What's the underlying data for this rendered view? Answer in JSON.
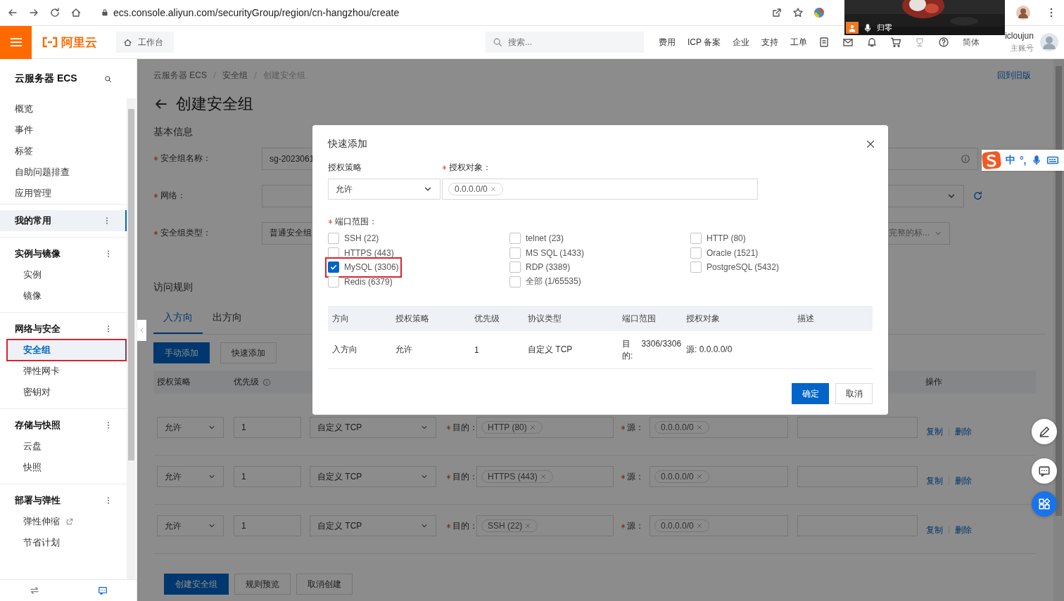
{
  "browser": {
    "url": "ecs.console.aliyun.com/securityGroup/region/cn-hangzhou/create"
  },
  "video_overlay": {
    "kind": "picture",
    "control_label": "归零"
  },
  "topnav": {
    "logo": "阿里云",
    "workbench": "工作台",
    "search": {
      "placeholder": "搜索..."
    },
    "links": [
      "费用",
      "ICP 备案",
      "企业",
      "支持",
      "工单"
    ],
    "language": "简体",
    "account": {
      "name": "icloujun",
      "role": "主账号"
    }
  },
  "sidebar": {
    "title": "云服务器 ECS",
    "items": [
      {
        "label": "概览",
        "selected": false
      },
      {
        "label": "事件",
        "selected": false
      },
      {
        "label": "标签",
        "selected": false
      },
      {
        "label": "自助问题排查",
        "selected": false
      },
      {
        "label": "应用管理",
        "selected": false
      }
    ],
    "groups": [
      {
        "title": "我的常用",
        "selected": true
      },
      {
        "title": "实例与镜像",
        "selected": false,
        "items": [
          {
            "label": "实例",
            "selected": false,
            "outlined": false,
            "external": false
          },
          {
            "label": "镜像",
            "selected": false,
            "outlined": false,
            "external": false
          }
        ]
      },
      {
        "title": "网络与安全",
        "selected": false,
        "items": [
          {
            "label": "安全组",
            "selected": true,
            "outlined": true,
            "external": false
          },
          {
            "label": "弹性网卡",
            "selected": false,
            "outlined": false,
            "external": false
          },
          {
            "label": "密钥对",
            "selected": false,
            "outlined": false,
            "external": false
          }
        ]
      },
      {
        "title": "存储与快照",
        "selected": false,
        "items": [
          {
            "label": "云盘",
            "selected": false,
            "outlined": false,
            "external": false
          },
          {
            "label": "快照",
            "selected": false,
            "outlined": false,
            "external": false
          }
        ]
      },
      {
        "title": "部署与弹性",
        "selected": false,
        "items": [
          {
            "label": "弹性伸缩",
            "selected": false,
            "outlined": false,
            "external": true
          },
          {
            "label": "节省计划",
            "selected": false,
            "outlined": false,
            "external": false
          }
        ]
      }
    ]
  },
  "main": {
    "breadcrumb": [
      "云服务器 ECS",
      "安全组",
      "创建安全组"
    ],
    "old_version_link": "回到旧版",
    "title": "创建安全组",
    "basic_section": "基本信息",
    "fields": [
      {
        "label": "安全组名称：",
        "kind": "text",
        "value": "sg-2023061"
      },
      {
        "label": "网络：",
        "kind": "select"
      },
      {
        "label": "安全组类型：",
        "kind": "type",
        "value": "普通安全组",
        "placeholder": "完整的标..."
      }
    ],
    "rules_section": "访问规则",
    "tabs": [
      {
        "label": "入方向",
        "selected": true
      },
      {
        "label": "出方向",
        "selected": false
      }
    ],
    "actions": [
      {
        "label": "手动添加",
        "kind": "primary"
      },
      {
        "label": "快速添加",
        "kind": "default"
      }
    ],
    "rules_table": {
      "columns": [
        "授权策略",
        "优先级",
        "操作"
      ],
      "rows": [
        {
          "policy": "允许",
          "priority": "1",
          "protocol": "自定义 TCP",
          "dest_label": "目的：",
          "dest_tag": "HTTP (80)",
          "source_label": "源：",
          "source_tag": "0.0.0.0/0",
          "copy": "复制",
          "delete": "删除"
        },
        {
          "policy": "允许",
          "priority": "1",
          "protocol": "自定义 TCP",
          "dest_label": "目的：",
          "dest_tag": "HTTPS (443)",
          "source_label": "源：",
          "source_tag": "0.0.0.0/0",
          "copy": "复制",
          "delete": "删除"
        },
        {
          "policy": "允许",
          "priority": "1",
          "protocol": "自定义 TCP",
          "dest_label": "目的：",
          "dest_tag": "SSH (22)",
          "source_label": "源：",
          "source_tag": "0.0.0.0/0",
          "copy": "复制",
          "delete": "删除"
        }
      ]
    },
    "footer_buttons": [
      {
        "label": "创建安全组",
        "kind": "primary"
      },
      {
        "label": "规则预览",
        "kind": "default"
      },
      {
        "label": "取消创建",
        "kind": "default"
      }
    ]
  },
  "modal": {
    "title": "快速添加",
    "policy_label": "授权策略",
    "policy_value": "允许",
    "target_label": "授权对象：",
    "target_tags": [
      "0.0.0.0/0"
    ],
    "port_label": "端口范围：",
    "ports": [
      {
        "label": "SSH (22)",
        "checked": false,
        "outlined": false
      },
      {
        "label": "HTTPS (443)",
        "checked": false,
        "outlined": false
      },
      {
        "label": "MySQL (3306)",
        "checked": true,
        "outlined": true
      },
      {
        "label": "Redis (6379)",
        "checked": false,
        "outlined": false
      },
      {
        "label": "telnet (23)",
        "checked": false,
        "outlined": false
      },
      {
        "label": "MS SQL (1433)",
        "checked": false,
        "outlined": false
      },
      {
        "label": "RDP (3389)",
        "checked": false,
        "outlined": false
      },
      {
        "label": "全部 (1/65535)",
        "checked": false,
        "outlined": false
      },
      {
        "label": "HTTP (80)",
        "checked": false,
        "outlined": false
      },
      {
        "label": "Oracle (1521)",
        "checked": false,
        "outlined": false
      },
      {
        "label": "PostgreSQL (5432)",
        "checked": false,
        "outlined": false
      }
    ],
    "table": {
      "columns": [
        "方向",
        "授权策略",
        "优先级",
        "协议类型",
        "端口范围",
        "授权对象",
        "描述"
      ],
      "rows": [
        {
          "direction": "入方向",
          "policy": "允许",
          "priority": "1",
          "protocol": "自定义 TCP",
          "port_label": "目的:",
          "port": "3306/3306",
          "target": "源: 0.0.0.0/0"
        }
      ]
    },
    "buttons": [
      {
        "label": "确定",
        "kind": "primary"
      },
      {
        "label": "取消",
        "kind": "default"
      }
    ]
  },
  "ime": {
    "mode": "中",
    "punctuation": "°,"
  }
}
